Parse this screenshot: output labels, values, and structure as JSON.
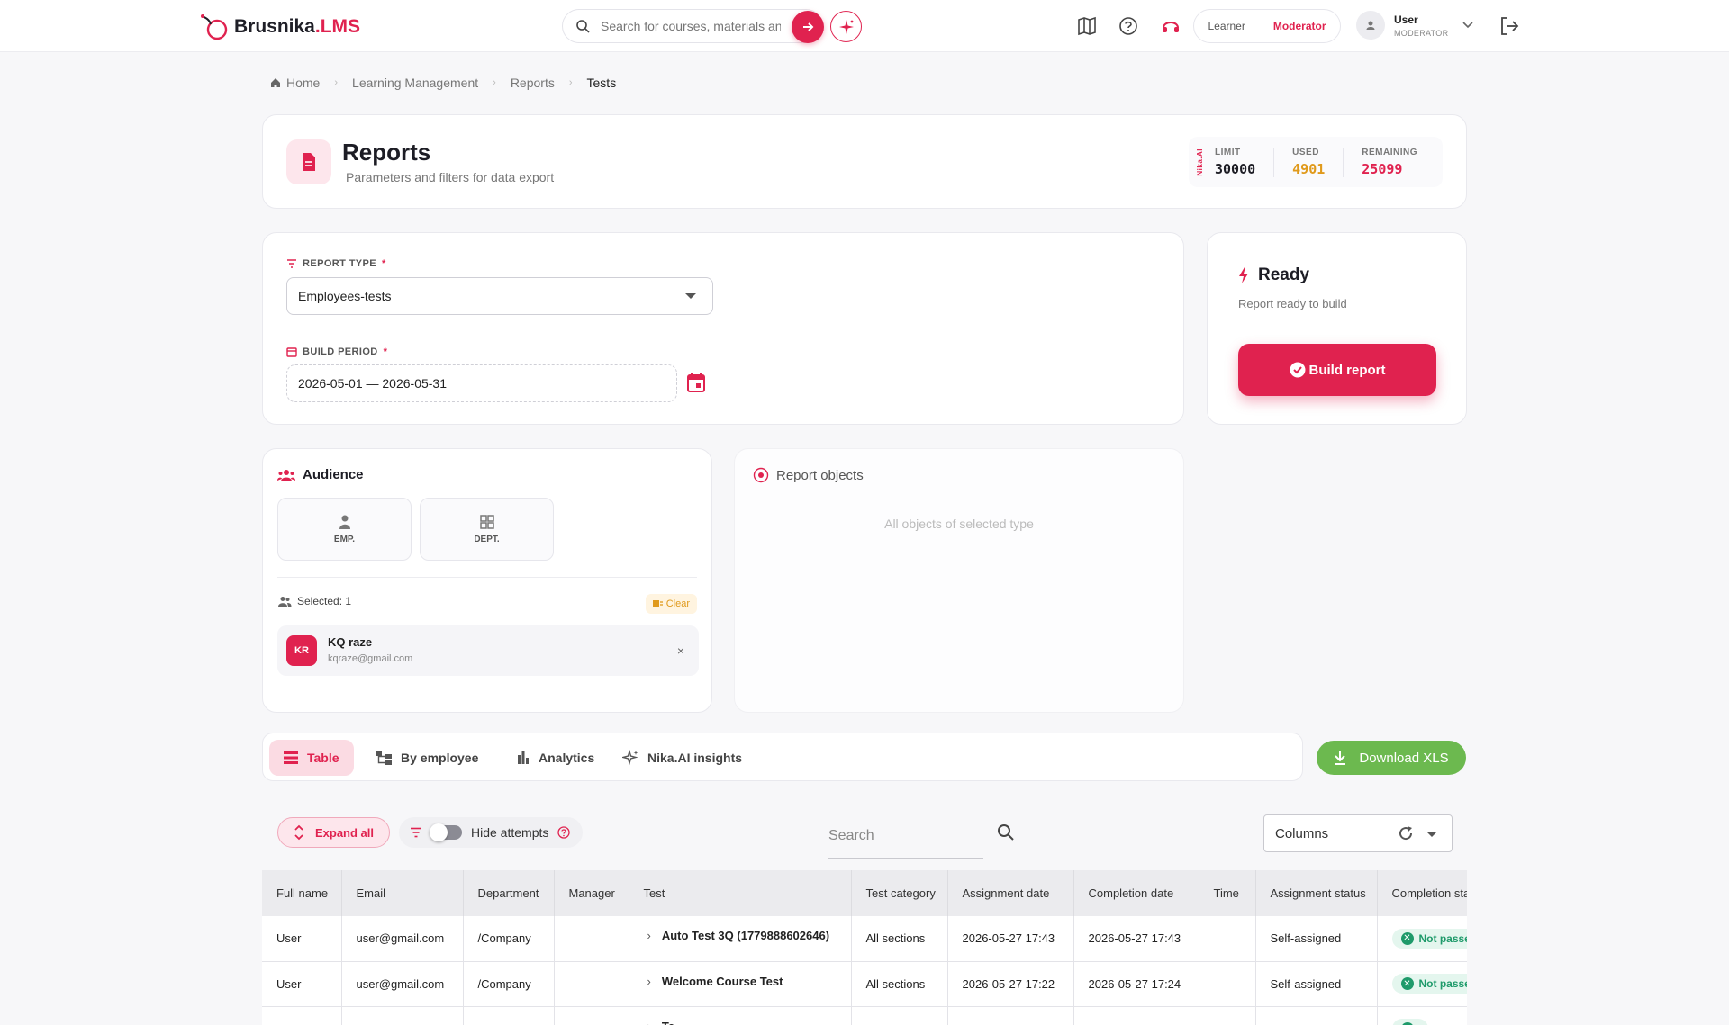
{
  "header": {
    "logo_main": "Brusnika",
    "logo_suffix": ".LMS",
    "search_placeholder": "Search for courses, materials and more",
    "role_learner": "Learner",
    "role_moderator": "Moderator",
    "user_name": "User",
    "user_role": "MODERATOR"
  },
  "breadcrumb": {
    "home": "Home",
    "item1": "Learning Management",
    "item2": "Reports",
    "current": "Tests"
  },
  "page": {
    "title": "Reports",
    "subtitle": "Parameters and filters for data export",
    "quota_brand": "Nika.AI",
    "limit_label": "LIMIT",
    "limit_value": "30000",
    "used_label": "USED",
    "used_value": "4901",
    "remaining_label": "REMAINING",
    "remaining_value": "25099"
  },
  "params": {
    "report_type_label": "REPORT TYPE",
    "report_type_value": "Employees-tests",
    "period_label": "BUILD PERIOD",
    "period_value": "2026-05-01 — 2026-05-31",
    "required_mark": "*"
  },
  "ready": {
    "title": "Ready",
    "desc": "Report ready to build",
    "button": "Build report"
  },
  "audience": {
    "title": "Audience",
    "tile_emp": "EMP.",
    "tile_dept": "DEPT.",
    "selected": "Selected: 1",
    "clear": "Clear",
    "person_initials": "KR",
    "person_name": "KQ raze",
    "person_email": "kqraze@gmail.com",
    "remove": "×"
  },
  "objects": {
    "title": "Report objects",
    "empty": "All objects of selected type"
  },
  "tabs": {
    "table": "Table",
    "by_employee": "By employee",
    "analytics": "Analytics",
    "insights": "Nika.AI insights",
    "download": "Download XLS"
  },
  "controls": {
    "expand": "Expand all",
    "hide_attempts": "Hide attempts",
    "search_placeholder": "Search",
    "columns": "Columns"
  },
  "table": {
    "headers": [
      "Full name",
      "Email",
      "Department",
      "Manager",
      "Test",
      "Test category",
      "Assignment date",
      "Completion date",
      "Time",
      "Assignment status",
      "Completion status"
    ],
    "rows": [
      [
        "User",
        "user@gmail.com",
        "/Company",
        "",
        "Auto Test 3Q (1779888602646)",
        "All sections",
        "2026-05-27 17:43",
        "2026-05-27 17:43",
        "",
        "Self-assigned",
        "Not passed"
      ],
      [
        "User",
        "user@gmail.com",
        "/Company",
        "",
        "Welcome Course Test",
        "All sections",
        "2026-05-27 17:22",
        "2026-05-27 17:24",
        "",
        "Self-assigned",
        "Not passed"
      ],
      [
        "",
        "",
        "",
        "",
        "Te",
        "",
        "",
        "",
        "",
        "",
        ""
      ]
    ]
  },
  "colors": {
    "accent": "#e0224f",
    "used": "#e09a1c",
    "download": "#6cb94f",
    "badge": "#1e9a6a"
  }
}
